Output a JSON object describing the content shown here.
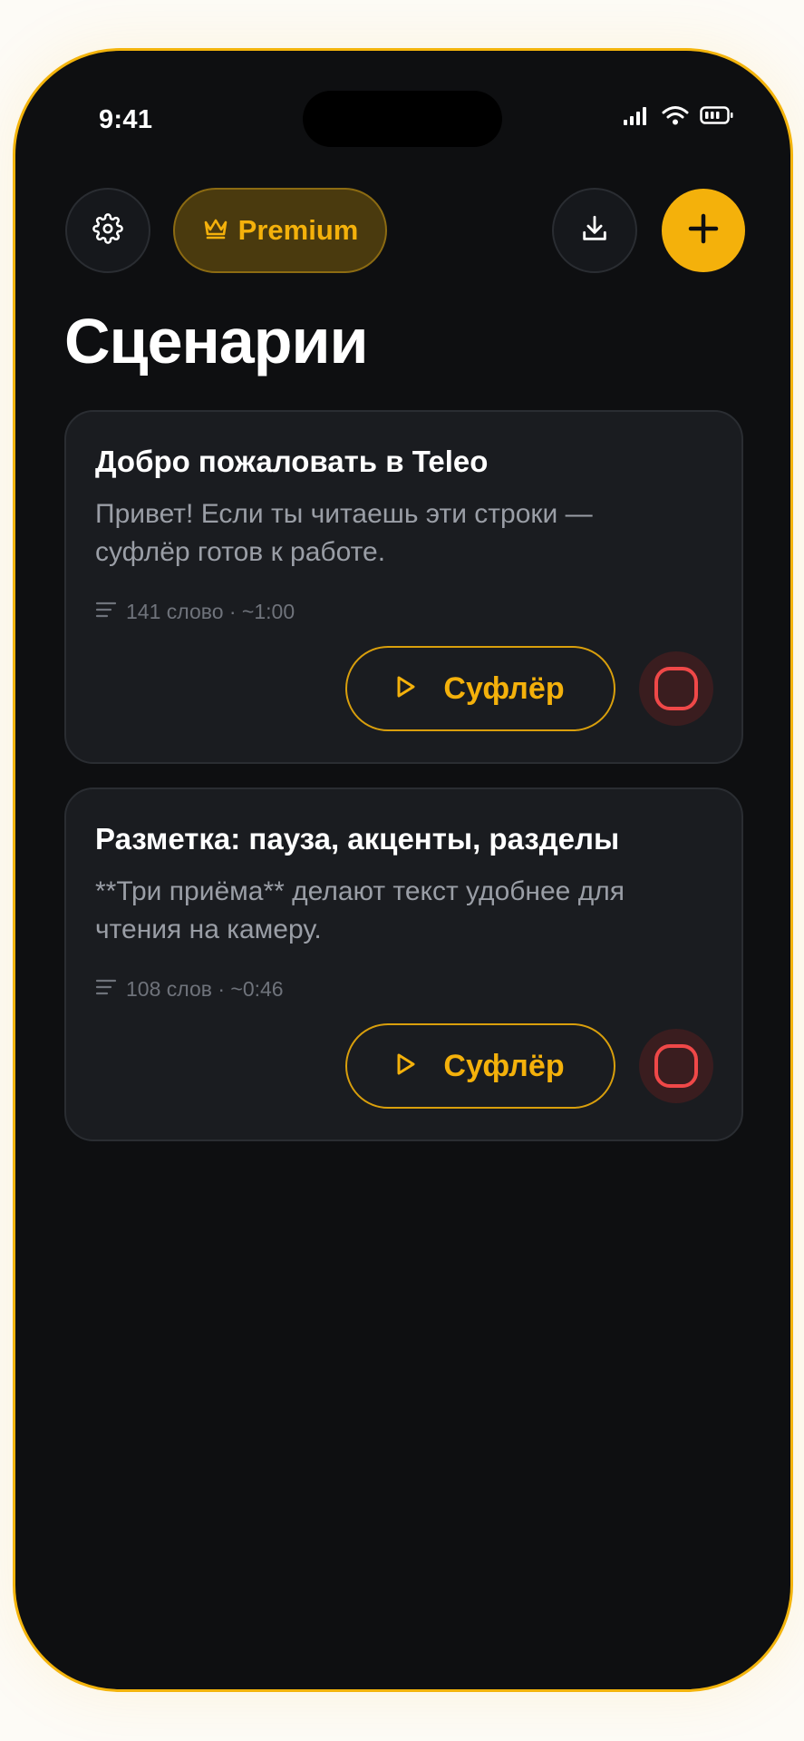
{
  "status_bar": {
    "time": "9:41",
    "icons": [
      "signal-icon",
      "wifi-icon",
      "battery-icon"
    ]
  },
  "toolbar": {
    "settings_icon": "gear-icon",
    "premium_label": "Premium",
    "premium_icon": "crown-icon",
    "import_icon": "download-icon",
    "add_icon": "plus-icon"
  },
  "page": {
    "title": "Сценарии"
  },
  "scripts": [
    {
      "title": "Добро пожаловать в Teleo",
      "preview": "Привет! Если ты читаешь эти строки — суфлёр готов к работе.",
      "meta": "141 слово · ~1:00",
      "prompter_label": "Суфлёр"
    },
    {
      "title": "Разметка: пауза, акценты, разделы",
      "preview": "**Три приёма** делают текст удобнее для чтения на камеру.",
      "meta": "108 слов · ~0:46",
      "prompter_label": "Суфлёр"
    }
  ],
  "colors": {
    "accent": "#f4b10b",
    "background": "#0e0f11",
    "card": "#1a1c20",
    "record": "#ef4848"
  }
}
